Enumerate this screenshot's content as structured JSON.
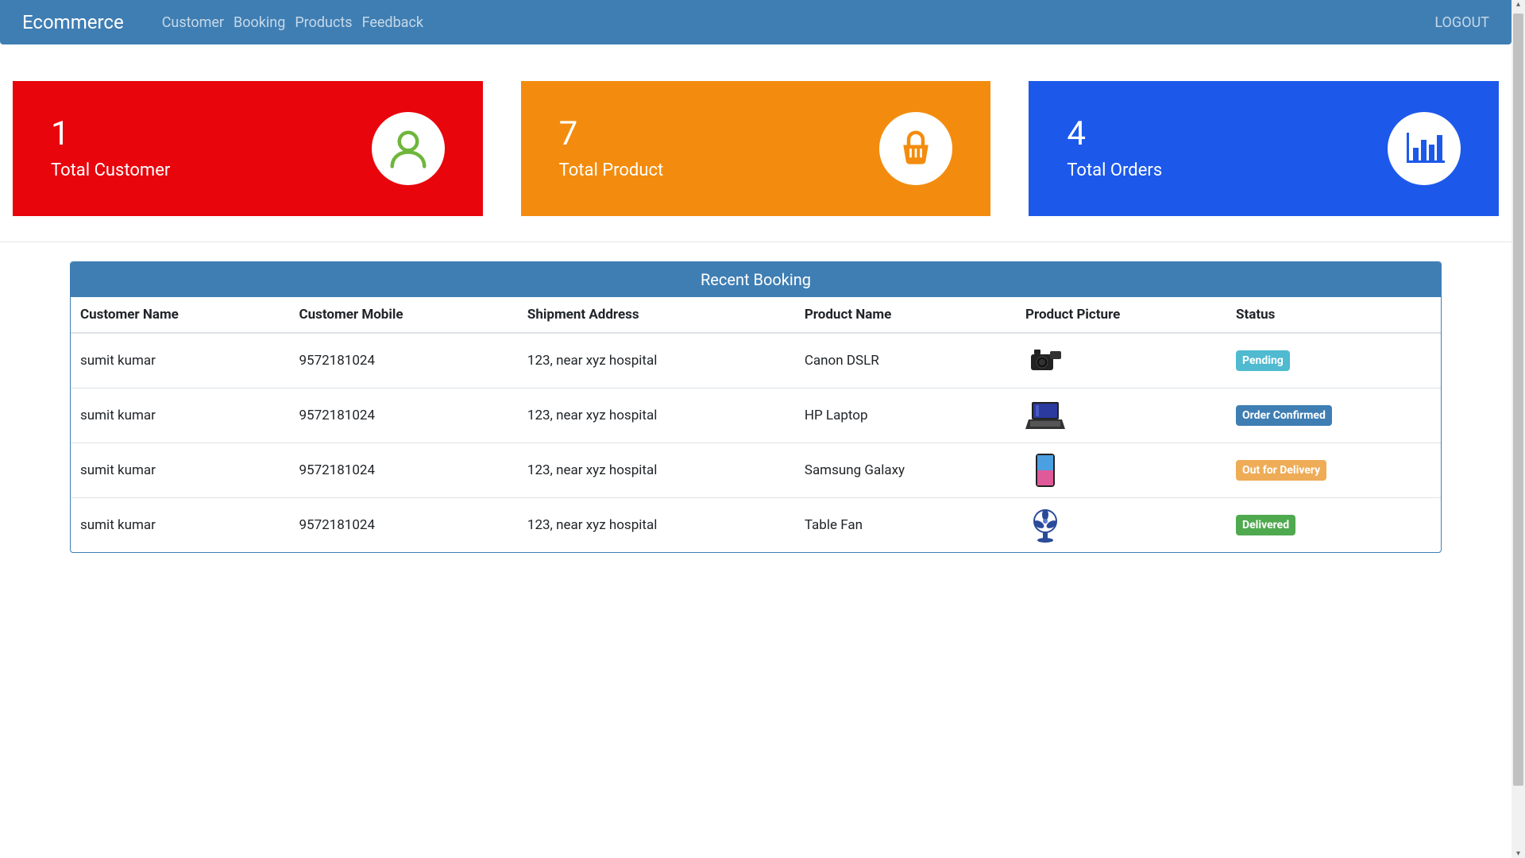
{
  "navbar": {
    "brand": "Ecommerce",
    "links": [
      "Customer",
      "Booking",
      "Products",
      "Feedback"
    ],
    "logout": "LOGOUT"
  },
  "stats": [
    {
      "value": "1",
      "label": "Total Customer",
      "icon": "user",
      "color": "red"
    },
    {
      "value": "7",
      "label": "Total Product",
      "icon": "basket",
      "color": "orange"
    },
    {
      "value": "4",
      "label": "Total Orders",
      "icon": "barchart",
      "color": "blue"
    }
  ],
  "booking": {
    "title": "Recent Booking",
    "columns": [
      "Customer Name",
      "Customer Mobile",
      "Shipment Address",
      "Product Name",
      "Product Picture",
      "Status"
    ],
    "rows": [
      {
        "name": "sumit kumar",
        "mobile": "9572181024",
        "address": "123, near xyz hospital",
        "product": "Canon DSLR",
        "pic": "camera",
        "status": "Pending",
        "badge": "info"
      },
      {
        "name": "sumit kumar",
        "mobile": "9572181024",
        "address": "123, near xyz hospital",
        "product": "HP Laptop",
        "pic": "laptop",
        "status": "Order Confirmed",
        "badge": "primary"
      },
      {
        "name": "sumit kumar",
        "mobile": "9572181024",
        "address": "123, near xyz hospital",
        "product": "Samsung Galaxy",
        "pic": "phone",
        "status": "Out for Delivery",
        "badge": "warning"
      },
      {
        "name": "sumit kumar",
        "mobile": "9572181024",
        "address": "123, near xyz hospital",
        "product": "Table Fan",
        "pic": "fan",
        "status": "Delivered",
        "badge": "success"
      }
    ]
  }
}
